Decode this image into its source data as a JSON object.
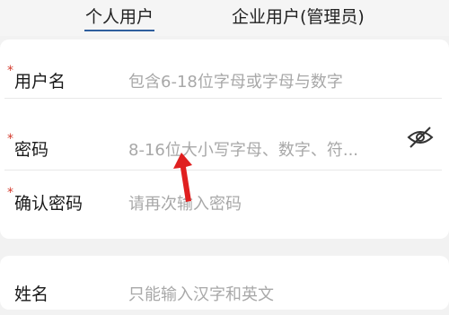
{
  "tabs": {
    "personal": "个人用户",
    "enterprise": "企业用户(管理员)"
  },
  "form": {
    "required_mark": "*",
    "username_label": "用户名",
    "username_placeholder": "包含6-18位字母或字母与数字",
    "password_label": "密码",
    "password_placeholder": "8-16位大小写字母、数字、符...",
    "confirm_label": "确认密码",
    "confirm_placeholder": "请再次输入密码",
    "name_label": "姓名",
    "name_placeholder": "只能输入汉字和英文"
  },
  "icons": {
    "password_toggle": "eye-off-icon",
    "annotation": "red-arrow-icon"
  },
  "colors": {
    "tab_underline": "#2f5f9e",
    "required_mark": "#d33a2c",
    "annotation_arrow": "#e02020"
  }
}
